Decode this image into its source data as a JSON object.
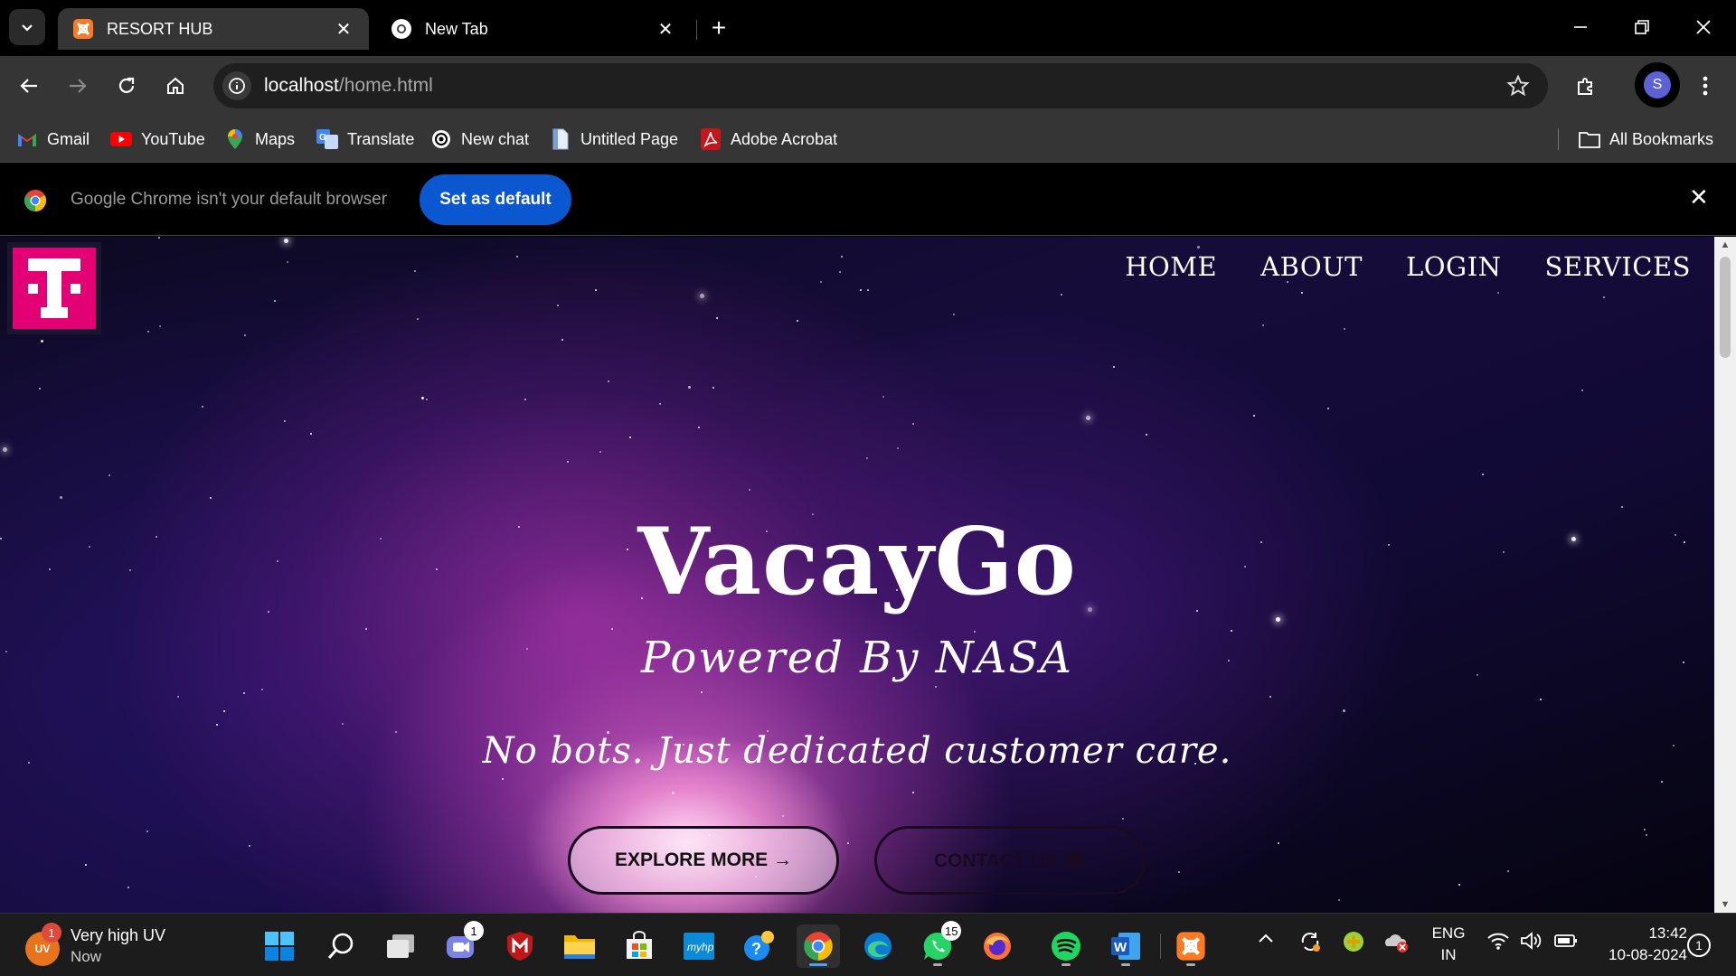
{
  "browser": {
    "tabs": [
      {
        "title": "RESORT HUB",
        "favicon": "xampp-icon",
        "close": "✕"
      },
      {
        "title": "New Tab",
        "favicon": "chrome-icon",
        "close": "✕"
      }
    ],
    "new_tab_symbol": "+",
    "window_controls": {
      "minimize": "—",
      "restore": "❐",
      "close": "✕"
    },
    "address": {
      "host": "localhost",
      "path": "/home.html"
    },
    "profile_initial": "S",
    "bookmarks": [
      {
        "label": "Gmail",
        "icon": "gmail-icon"
      },
      {
        "label": "YouTube",
        "icon": "youtube-icon"
      },
      {
        "label": "Maps",
        "icon": "maps-icon"
      },
      {
        "label": "Translate",
        "icon": "translate-icon"
      },
      {
        "label": "New chat",
        "icon": "openai-icon"
      },
      {
        "label": "Untitled Page",
        "icon": "page-icon"
      },
      {
        "label": "Adobe Acrobat",
        "icon": "acrobat-icon"
      }
    ],
    "all_bookmarks": "All Bookmarks",
    "infobar": {
      "message": "Google Chrome isn't your default browser",
      "button": "Set as default",
      "close": "✕"
    }
  },
  "page": {
    "logo_letter": "T",
    "logo_color": "#e20074",
    "nav": [
      "HOME",
      "ABOUT",
      "LOGIN",
      "SERVICES"
    ],
    "hero": {
      "title": "VacayGo",
      "subtitle": "Powered By NASA",
      "tagline": "No bots. Just dedicated customer care.",
      "explore_button": "EXPLORE MORE →",
      "contact_button": "CONTACT US ☎"
    }
  },
  "taskbar": {
    "weather": {
      "icon_text": "UV",
      "badge": "1",
      "line1": "Very high UV",
      "line2": "Now"
    },
    "apps": [
      {
        "name": "start-icon"
      },
      {
        "name": "search-icon"
      },
      {
        "name": "task-view-icon"
      },
      {
        "name": "teams-icon",
        "badge": "1"
      },
      {
        "name": "mcafee-icon"
      },
      {
        "name": "file-explorer-icon"
      },
      {
        "name": "microsoft-store-icon"
      },
      {
        "name": "myhp-icon",
        "label": "myhp"
      },
      {
        "name": "get-help-icon"
      },
      {
        "name": "chrome-icon"
      },
      {
        "name": "edge-icon"
      },
      {
        "name": "whatsapp-icon",
        "badge": "15"
      },
      {
        "name": "firefox-icon"
      },
      {
        "name": "spotify-icon"
      },
      {
        "name": "word-icon",
        "label": "W"
      },
      {
        "name": "xampp-icon"
      }
    ],
    "language": {
      "line1": "ENG",
      "line2": "IN"
    },
    "clock": {
      "time": "13:42",
      "date": "10-08-2024"
    },
    "notification_count": "1"
  }
}
